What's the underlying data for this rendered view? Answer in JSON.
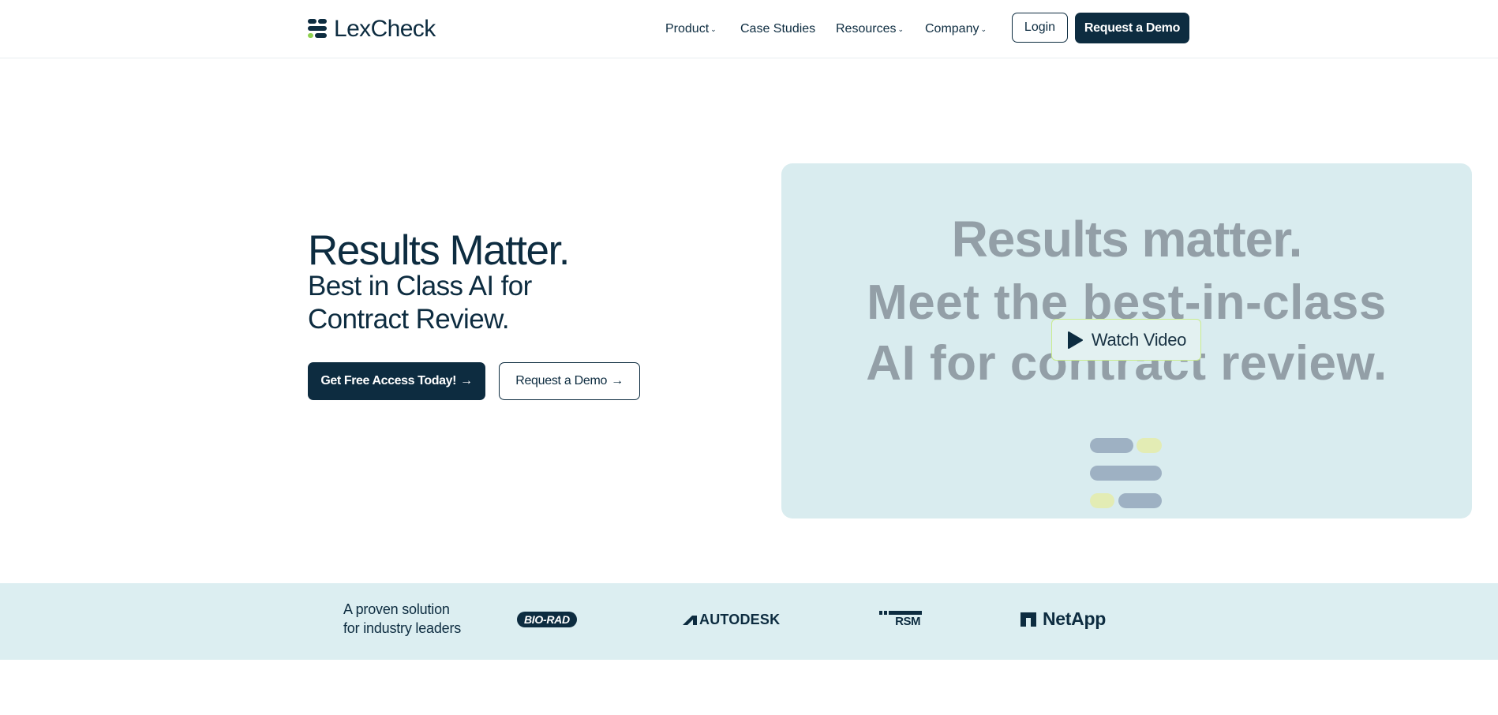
{
  "header": {
    "brand": "LexCheck",
    "nav": [
      {
        "label": "Product",
        "has_caret": true
      },
      {
        "label": "Case Studies",
        "has_caret": false
      },
      {
        "label": "Resources",
        "has_caret": true
      },
      {
        "label": "Company",
        "has_caret": true
      }
    ],
    "login_label": "Login",
    "demo_label": "Request a Demo"
  },
  "hero": {
    "title": "Results Matter.",
    "subtitle": "Best in Class AI for Contract Review.",
    "primary_cta": "Get Free Access Today!",
    "secondary_cta": "Request a Demo",
    "arrow": "→"
  },
  "video": {
    "headline": "Results matter.",
    "subline_1": "Meet the best-in-class",
    "subline_2": "AI for contract review.",
    "watch_label": "Watch Video"
  },
  "proof": {
    "text_line1": "A proven solution",
    "text_line2": "for industry leaders",
    "logos": [
      "BIO-RAD",
      "AUTODESK",
      "RSM",
      "NetApp"
    ]
  },
  "colors": {
    "navy": "#0d2c40",
    "accent_green": "#8fd14f",
    "card_bg": "#d9ecef",
    "strip_bg": "#dceef1"
  }
}
